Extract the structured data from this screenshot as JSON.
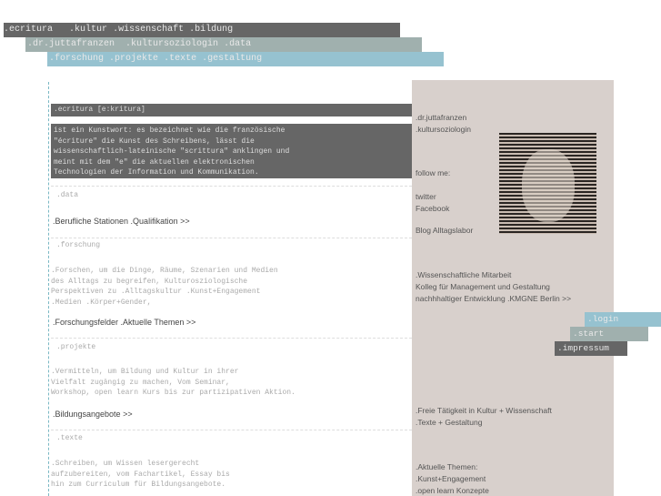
{
  "nav": {
    "row1": [
      ".ecritura",
      ".kultur",
      ".wissenschaft",
      ".bildung"
    ],
    "row2": [
      ".dr.juttafranzen",
      ".kultursoziologin",
      ".data"
    ],
    "row3": [
      ".forschung",
      ".projekte",
      ".texte",
      ".gestaltung"
    ]
  },
  "main": {
    "title": ".ecritura [e:kritura]",
    "intro": "ist ein Kunstwort: es bezeichnet wie die französische\n\"écriture\" die Kunst des Schreibens, lässt die\nwissenschaftlich-lateinische \"scrittura\" anklingen und\nmeint mit dem \"e\" die aktuellen elektronischen\nTechnologien der Information und Kommunikation.",
    "sections": [
      {
        "label": ".data",
        "text": "",
        "link": ".Berufliche Stationen .Qualifikation >>"
      },
      {
        "label": ".forschung",
        "text": ".Forschen, um die Dinge, Räume, Szenarien und Medien\ndes Alltags zu begreifen, Kulturosziologische\nPerspektiven zu .Alltagskultur .Kunst+Engagement\n.Medien .Körper+Gender,",
        "link": ".Forschungsfelder .Aktuelle Themen >>"
      },
      {
        "label": ".projekte",
        "text": ".Vermitteln, um Bildung und Kultur in ihrer\nVielfalt zugängig zu machen, Vom Seminar,\nWorkshop, open learn Kurs bis zur partizipativen Aktion.",
        "link": ".Bildungsangebote >>"
      },
      {
        "label": ".texte",
        "text": ".Schreiben, um Wissen lesergerecht\naufzubereiten, vom Fachartikel, Essay bis\nhin zum Curriculum für Bildungsangebote."
      }
    ]
  },
  "sidebar": {
    "name": ".dr.juttafranzen",
    "role": ".kultursoziologin",
    "follow": "follow me:",
    "twitter": "twitter",
    "facebook": "Facebook",
    "blog": "Blog Alltagslabor",
    "work": [
      ".Wissenschaftliche Mitarbeit",
      "Kolleg für Management und Gestaltung",
      "nachhhaltiger Entwicklung .KMGNE Berlin >>"
    ],
    "freelance": [
      ".Freie Tätigkeit in Kultur + Wissenschaft",
      ".Texte + Gestaltung"
    ],
    "topics": [
      ".Aktuelle Themen:",
      ".Kunst+Engagement",
      ".open learn Konzepte"
    ]
  },
  "buttons": {
    "login": ".login",
    "start": ".start",
    "impressum": ".impressum"
  },
  "colors": {
    "dark": "#666666",
    "grey": "#a0b0ae",
    "teal": "#96c2d0",
    "sidebar": "#d8d0cc"
  }
}
